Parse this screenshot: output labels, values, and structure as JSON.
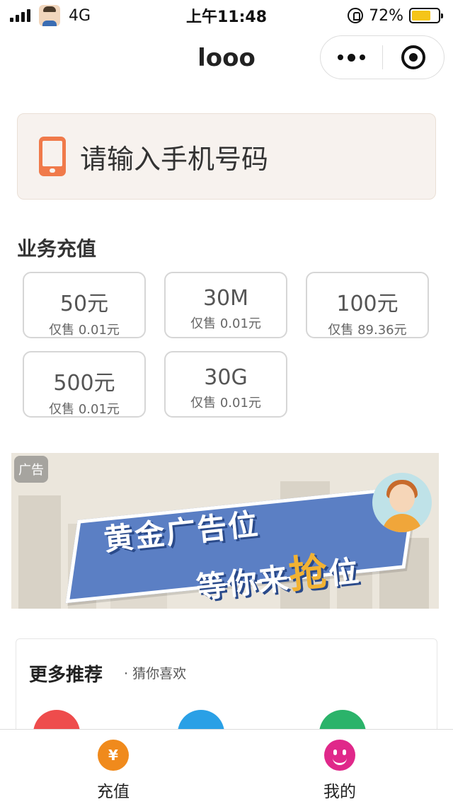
{
  "status_bar": {
    "network": "4G",
    "time": "上午11:48",
    "battery": "72%",
    "battery_level": 0.72
  },
  "header": {
    "title": "looo"
  },
  "phone_input": {
    "placeholder": "请输入手机号码"
  },
  "recharge": {
    "section_title": "业务充值",
    "items": [
      {
        "label": "50元",
        "price": "仅售 0.01元"
      },
      {
        "label": "30M",
        "price": "仅售 0.01元"
      },
      {
        "label": "100元",
        "price": "仅售 89.36元"
      },
      {
        "label": "500元",
        "price": "仅售 0.01元"
      },
      {
        "label": "30G",
        "price": "仅售 0.01元"
      }
    ]
  },
  "ad": {
    "tag": "广告",
    "line1": "黄金广告位",
    "line2_prefix": "等你来",
    "line2_highlight": "抢",
    "line2_suffix": "位"
  },
  "more": {
    "title": "更多推荐",
    "subtitle": "· 猜你喜欢"
  },
  "tabbar": {
    "items": [
      {
        "label": "充值",
        "icon": "yen-icon",
        "color": "#f08a1c"
      },
      {
        "label": "我的",
        "icon": "smile-icon",
        "color": "#e0288a"
      }
    ]
  },
  "colors": {
    "accent_orange": "#f07a4a",
    "ad_blue": "#5b7fc4",
    "ad_gold": "#f2b233"
  }
}
